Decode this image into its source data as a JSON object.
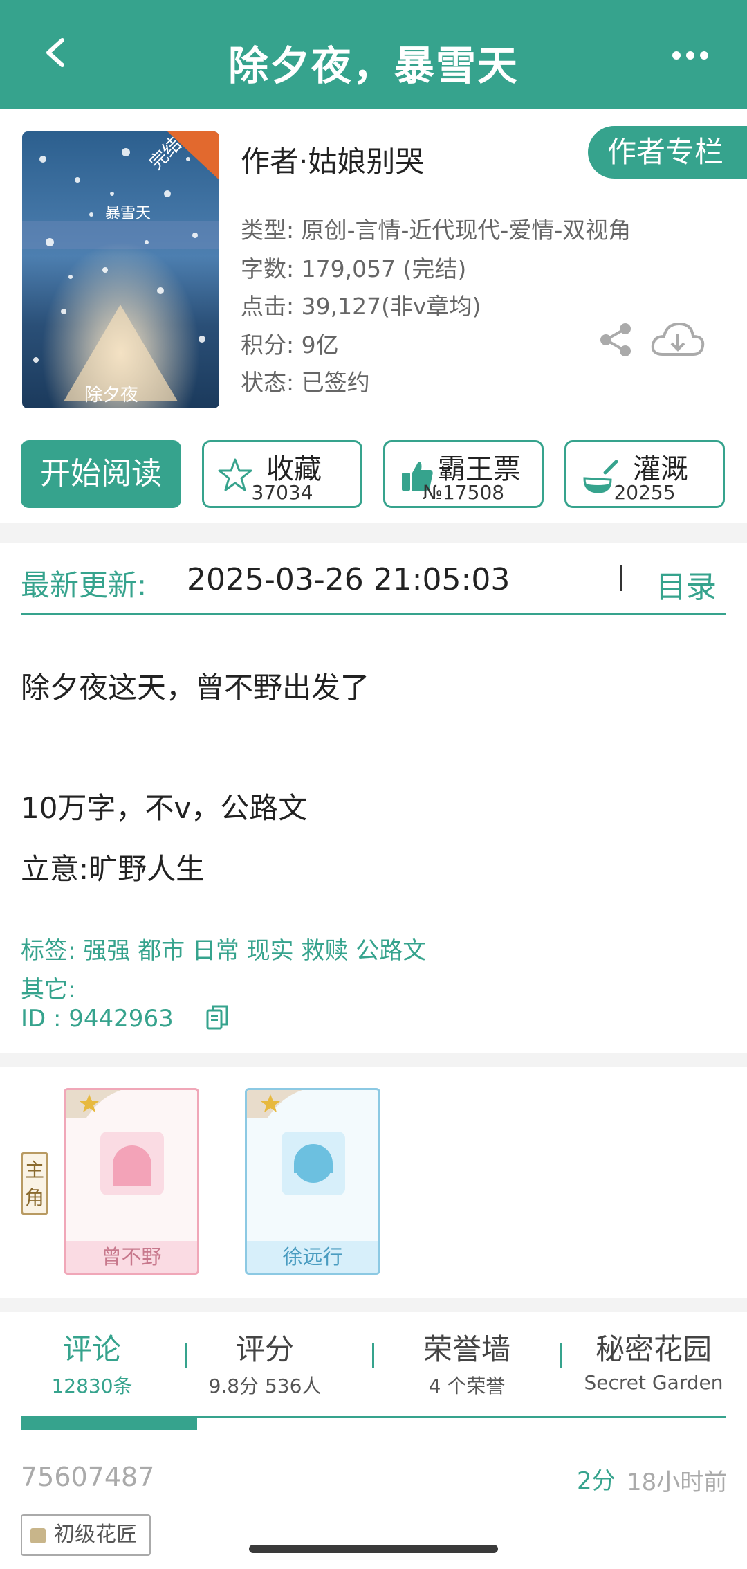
{
  "header": {
    "title": "除夕夜，暴雪天"
  },
  "book": {
    "cover_title": "暴雪天",
    "cover_badge": "完结",
    "cover_bottom_title": "除夕夜",
    "author_label": "作者·姑娘别哭",
    "column_button": "作者专栏",
    "type": "类型: 原创-言情-近代现代-爱情-双视角",
    "words": "字数: 179,057 (完结)",
    "clicks": "点击: 39,127(非v章均)",
    "points": "积分: 9亿",
    "status": "状态: 已签约"
  },
  "actions": {
    "read": "开始阅读",
    "fav_label": "收藏",
    "fav_count": "37034",
    "ticket_label": "霸王票",
    "ticket_count": "№17508",
    "water_label": "灌溉",
    "water_count": "20255"
  },
  "update": {
    "label": "最新更新:",
    "time": "2025-03-26 21:05:03",
    "toc": "目录"
  },
  "description": {
    "line1": "除夕夜这天，曾不野出发了",
    "line2": "10万字，不v，公路文",
    "line3": "立意:旷野人生",
    "tags": "标签: 强强 都市 日常 现实 救赎 公路文",
    "other": "其它:",
    "id": "ID    :  9442963"
  },
  "characters": {
    "main_role": "主角",
    "items": [
      {
        "name": "曾不野",
        "color": "#f3a3b8"
      },
      {
        "name": "徐远行",
        "color": "#6cc0e0"
      }
    ]
  },
  "tabs": [
    {
      "title": "评论",
      "sub": "12830条"
    },
    {
      "title": "评分",
      "sub": "9.8分 536人"
    },
    {
      "title": "荣誉墙",
      "sub": "4 个荣誉"
    },
    {
      "title": "秘密花园",
      "sub": "Secret Garden"
    }
  ],
  "comment": {
    "user_id": "75607487",
    "score": "2分",
    "time_ago": "18小时前",
    "badge": "初级花匠"
  },
  "colors": {
    "accent": "#36a38d"
  }
}
